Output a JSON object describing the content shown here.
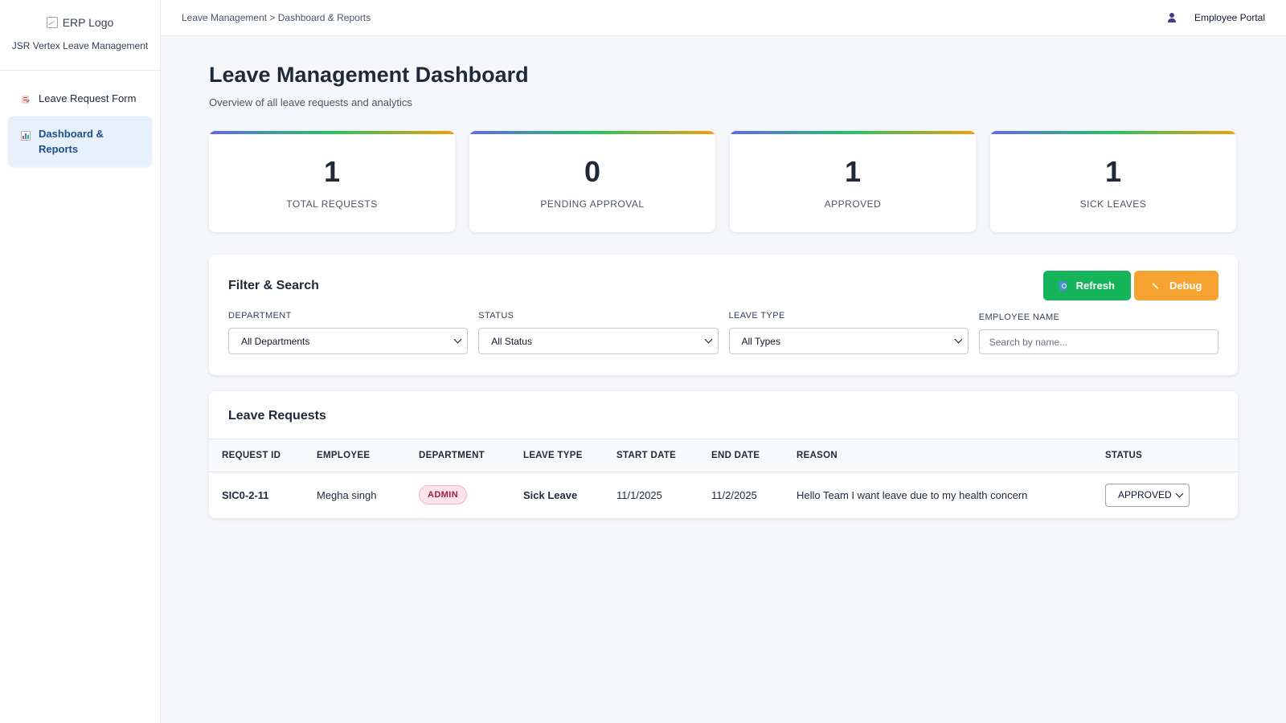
{
  "sidebar": {
    "logo_alt": "ERP Logo",
    "brand_name": "JSR Vertex Leave Management",
    "items": [
      {
        "label": "Leave Request Form",
        "icon": "form-icon",
        "active": false
      },
      {
        "label": "Dashboard & Reports",
        "icon": "chart-icon",
        "active": true
      }
    ]
  },
  "topbar": {
    "breadcrumb": "Leave Management > Dashboard & Reports",
    "portal_label": "Employee Portal",
    "user_icon": "user-icon"
  },
  "main": {
    "title": "Leave Management Dashboard",
    "subtitle": "Overview of all leave requests and analytics"
  },
  "stats": [
    {
      "value": "1",
      "label": "TOTAL REQUESTS"
    },
    {
      "value": "0",
      "label": "PENDING APPROVAL"
    },
    {
      "value": "1",
      "label": "APPROVED"
    },
    {
      "value": "1",
      "label": "SICK LEAVES"
    }
  ],
  "filters": {
    "title": "Filter & Search",
    "refresh_label": "Refresh",
    "debug_label": "Debug",
    "department_label": "DEPARTMENT",
    "department_value": "All Departments",
    "status_label": "STATUS",
    "status_value": "All Status",
    "leave_type_label": "LEAVE TYPE",
    "leave_type_value": "All Types",
    "employee_label": "EMPLOYEE NAME",
    "employee_placeholder": "Search by name..."
  },
  "requests": {
    "title": "Leave Requests",
    "columns": [
      "REQUEST ID",
      "EMPLOYEE",
      "DEPARTMENT",
      "LEAVE TYPE",
      "START DATE",
      "END DATE",
      "REASON",
      "STATUS"
    ],
    "rows": [
      {
        "id": "SIC0-2-11",
        "employee": "Megha singh",
        "department": "ADMIN",
        "leave_type": "Sick Leave",
        "start_date": "11/1/2025",
        "end_date": "11/2/2025",
        "reason": "Hello Team I want leave due to my health concern",
        "status": "APPROVED"
      }
    ]
  },
  "colors": {
    "accent": "#1e4f8a",
    "refresh": "#16b45a",
    "debug": "#f7a332",
    "badge": "#9b1c40"
  }
}
